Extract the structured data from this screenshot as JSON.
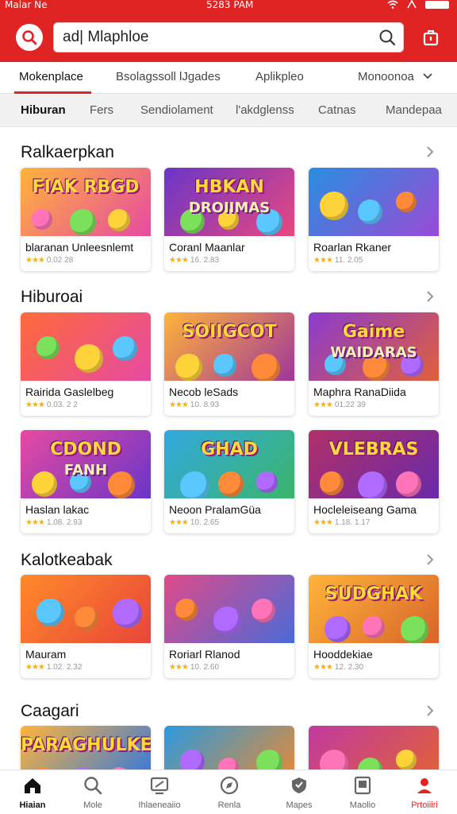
{
  "status_bar": {
    "left": "Malar Ne",
    "time": "5283 PAM"
  },
  "search": {
    "value": "ad| Mlaphloe"
  },
  "top_tabs": [
    {
      "label": "Mokenplace",
      "active": true
    },
    {
      "label": "Bsolagssoll lJgades"
    },
    {
      "label": "Aplikpleo"
    },
    {
      "label": "Monoonoa"
    }
  ],
  "category_tabs": [
    {
      "label": "Hiburan",
      "active": true
    },
    {
      "label": "Fers"
    },
    {
      "label": "Sendiolament"
    },
    {
      "label": "l'akdglenss"
    },
    {
      "label": "Catnas"
    },
    {
      "label": "Mandepaa"
    }
  ],
  "sections": [
    {
      "title": "Ralkaerpkan",
      "cards": [
        {
          "name": "blaranan Unleesnlemt",
          "rating": "0.02 28",
          "thumb_text": "FIAK RBGD",
          "thumb_sub": "",
          "colors": [
            "#ffb43a",
            "#e64aa2"
          ]
        },
        {
          "name": "Coranl Maanlar",
          "rating": "16. 2.83",
          "thumb_text": "HBKAN",
          "thumb_sub": "DROIIMAS",
          "colors": [
            "#6a35c8",
            "#e9487e"
          ]
        },
        {
          "name": "Roarlan Rkaner",
          "rating": "11. 2.05",
          "thumb_text": "",
          "thumb_sub": "",
          "colors": [
            "#2a8ee0",
            "#9a4ad6"
          ]
        }
      ]
    },
    {
      "title": "Hiburoai",
      "cards": [
        {
          "name": "Rairida Gaslelbeg",
          "rating": "0.03. 2 2",
          "thumb_text": "",
          "thumb_sub": "",
          "colors": [
            "#ff6a3a",
            "#e64aa2"
          ]
        },
        {
          "name": "Necob leSads",
          "rating": "10. 8.93",
          "thumb_text": "SOIIGCOT",
          "thumb_sub": "",
          "colors": [
            "#ffb43a",
            "#a1369a"
          ]
        },
        {
          "name": "Maphra RanaDiida",
          "rating": "01.22 39",
          "thumb_text": "Gaime",
          "thumb_sub": "WAIDARAS",
          "colors": [
            "#8a3ad0",
            "#e0603a"
          ]
        }
      ]
    },
    {
      "title": "",
      "cards": [
        {
          "name": "Haslan lakac",
          "rating": "1.08. 2.93",
          "thumb_text": "CDOND",
          "thumb_sub": "FANH",
          "colors": [
            "#e64aa2",
            "#6a35c8"
          ]
        },
        {
          "name": "Neoon PralamGüa",
          "rating": "10. 2.65",
          "thumb_text": "GHAD",
          "thumb_sub": "",
          "colors": [
            "#32a8e0",
            "#3bb56a"
          ]
        },
        {
          "name": "Hocleleiseang Gama",
          "rating": "1.18. 1.17",
          "thumb_text": "VLEBRAS",
          "thumb_sub": "",
          "colors": [
            "#b0306a",
            "#6a2aa8"
          ]
        }
      ]
    },
    {
      "title": "Kalotkeabak",
      "cards": [
        {
          "name": "Mauram",
          "rating": "1.02. 2.32",
          "thumb_text": "",
          "thumb_sub": "",
          "colors": [
            "#ff8a2a",
            "#e8453a"
          ]
        },
        {
          "name": "Roriarl Rlanod",
          "rating": "10. 2.60",
          "thumb_text": "",
          "thumb_sub": "",
          "colors": [
            "#e04a8a",
            "#4a6ad8"
          ]
        },
        {
          "name": "Hooddekiae",
          "rating": "12. 2.30",
          "thumb_text": "SUDGHAK",
          "thumb_sub": "",
          "colors": [
            "#ffb43a",
            "#d8642a"
          ]
        }
      ]
    },
    {
      "title": "Caagari",
      "cards": [
        {
          "name": "",
          "rating": "",
          "thumb_text": "PARAGHULKE",
          "thumb_sub": "",
          "colors": [
            "#ffb43a",
            "#3a7ad8"
          ]
        },
        {
          "name": "",
          "rating": "",
          "thumb_text": "",
          "thumb_sub": "",
          "colors": [
            "#2a9ae0",
            "#e08a3a"
          ]
        },
        {
          "name": "",
          "rating": "",
          "thumb_text": "",
          "thumb_sub": "",
          "colors": [
            "#c03aa0",
            "#e0603a"
          ]
        }
      ]
    }
  ],
  "bottom_nav": [
    {
      "label": "Hiaian",
      "icon": "home-icon",
      "active": true
    },
    {
      "label": "Mole",
      "icon": "search-icon"
    },
    {
      "label": "Ihlaeneaiio",
      "icon": "monitor-icon"
    },
    {
      "label": "Renla",
      "icon": "compass-icon"
    },
    {
      "label": "Mapes",
      "icon": "shield-icon"
    },
    {
      "label": "Maolio",
      "icon": "tablet-icon"
    },
    {
      "label": "Prtoiiiri",
      "icon": "profile-icon"
    }
  ],
  "colors": {
    "brand": "#e02424",
    "star": "#f2b01e"
  }
}
